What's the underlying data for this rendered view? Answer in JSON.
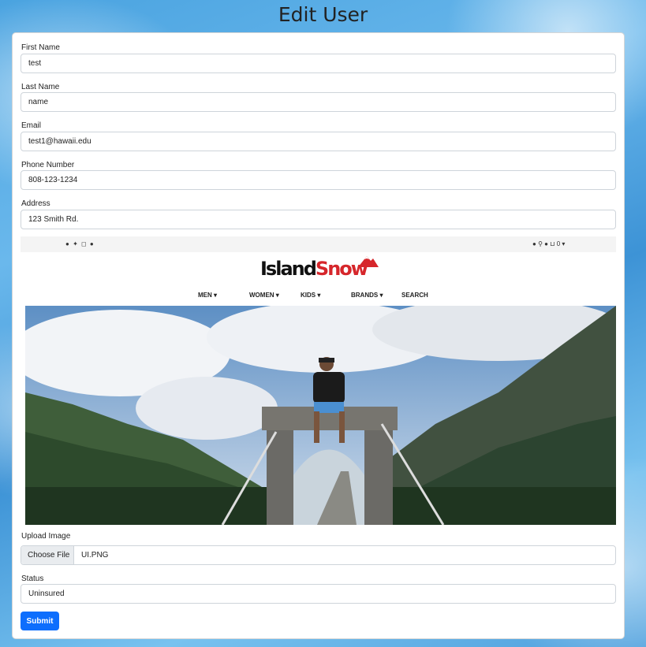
{
  "page": {
    "title": "Edit User"
  },
  "form": {
    "first_name": {
      "label": "First Name",
      "value": "test"
    },
    "last_name": {
      "label": "Last Name",
      "value": "name"
    },
    "email": {
      "label": "Email",
      "value": "test1@hawaii.edu"
    },
    "phone": {
      "label": "Phone Number",
      "value": "808-123-1234"
    },
    "address": {
      "label": "Address",
      "value": "123 Smith Rd."
    },
    "upload": {
      "label": "Upload Image",
      "button": "Choose File",
      "filename": "UI.PNG"
    },
    "status": {
      "label": "Status",
      "value": "Uninsured"
    },
    "submit_label": "Submit"
  },
  "preview": {
    "social_icons": [
      "facebook-icon",
      "twitter-icon",
      "instagram-icon",
      "pinterest-icon"
    ],
    "utility": {
      "cart_count": "0"
    },
    "logo": {
      "part1": "Island",
      "part2": "Snow"
    },
    "nav": [
      "MEN",
      "WOMEN",
      "KIDS",
      "BRANDS",
      "SEARCH"
    ]
  },
  "colors": {
    "primary": "#0d6efd",
    "logo_red": "#d6262b"
  }
}
